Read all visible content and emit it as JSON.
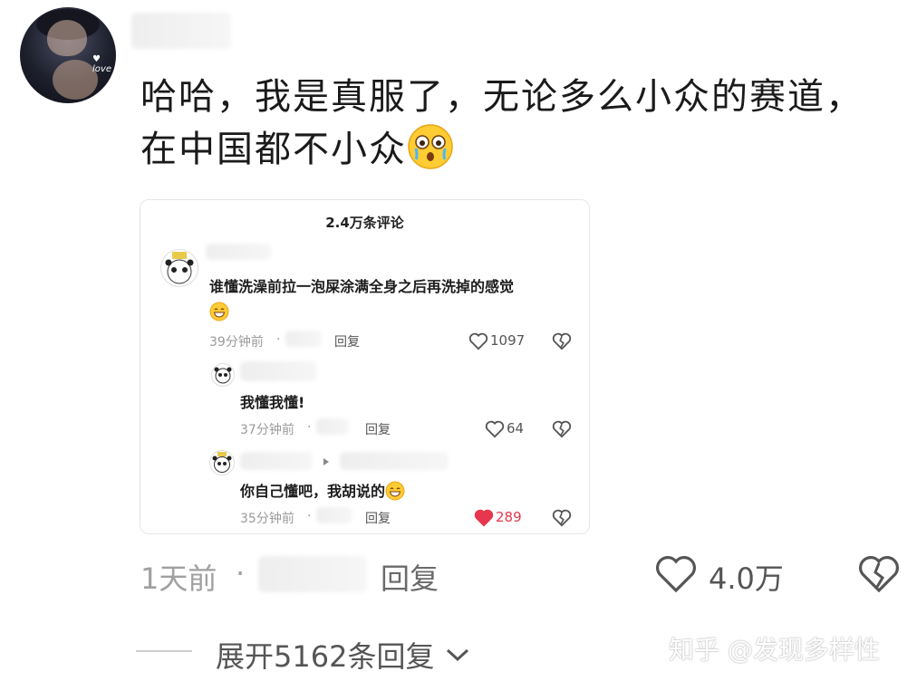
{
  "post": {
    "text_line1": "哈哈，我是真服了，无论多么小众的赛道，",
    "text_line2": "在中国都不小众",
    "time": "1天前",
    "dot": "·",
    "reply": "回复",
    "likes": "4.0万",
    "expand": "展开5162条回复"
  },
  "card": {
    "title": "2.4万条评论",
    "comments": [
      {
        "text": "谁懂洗澡前拉一泡屎涂满全身之后再洗掉的感觉",
        "time": "39分钟前",
        "dot": "·",
        "reply": "回复",
        "likes": "1097"
      },
      {
        "text": "我懂我懂!",
        "time": "37分钟前",
        "dot": "·",
        "reply": "回复",
        "likes": "64"
      },
      {
        "text": "你自己懂吧，我胡说的",
        "time": "35分钟前",
        "dot": "·",
        "reply": "回复",
        "likes": "289"
      }
    ]
  },
  "watermark": "知乎 @发现多样性",
  "colors": {
    "liked_heart": "#e8364f",
    "heart_outline": "#555555"
  }
}
